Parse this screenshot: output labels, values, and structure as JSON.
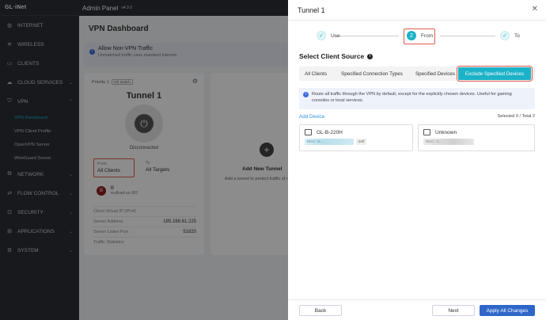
{
  "sidebar": {
    "logo": "GL·iNet",
    "app_title": "Admin Panel",
    "version": "v4.9.0",
    "items": [
      {
        "label": "INTERNET",
        "icon": "globe-icon"
      },
      {
        "label": "WIRELESS",
        "icon": "wifi-icon"
      },
      {
        "label": "CLIENTS",
        "icon": "monitor-icon"
      },
      {
        "label": "CLOUD SERVICES",
        "icon": "cloud-icon"
      },
      {
        "label": "VPN",
        "icon": "shield-icon"
      },
      {
        "label": "NETWORK",
        "icon": "network-icon"
      },
      {
        "label": "FLOW CONTROL",
        "icon": "flow-icon"
      },
      {
        "label": "SECURITY",
        "icon": "lock-icon"
      },
      {
        "label": "APPLICATIONS",
        "icon": "apps-icon"
      },
      {
        "label": "SYSTEM",
        "icon": "gear-icon"
      }
    ],
    "vpn_sub": [
      "VPN Dashboard",
      "VPN Client Profile",
      "OpenVPN Server",
      "WireGuard Server"
    ]
  },
  "background": {
    "page_title": "VPN Dashboard",
    "allow_title": "Allow Non-VPN Traffic",
    "allow_desc": "Unmatched traffic uses standard internet.",
    "priority": "Priority 1",
    "kill_switch": "Kill Switch",
    "tunnel_name": "Tunnel 1",
    "status": "Disconnected",
    "from_label": "From",
    "from_value": "All Clients",
    "to_label": "To",
    "to_value": "All Targets",
    "client_initial": "B",
    "client_name": "B",
    "client_sub": "mullvad-us-002",
    "rows": [
      {
        "label": "Client Virtual IP (IPv4)",
        "value": ""
      },
      {
        "label": "Server Address",
        "value": "185.188.61.225"
      },
      {
        "label": "Server Listen Port",
        "value": "51820"
      },
      {
        "label": "Traffic Statistics",
        "value": ""
      }
    ],
    "add_tunnel_title": "Add New Tunnel",
    "add_tunnel_desc": "Add a tunnel to protect traffic of routing rules."
  },
  "panel": {
    "title": "Tunnel 1",
    "steps": [
      {
        "num": "✓",
        "label": "Use"
      },
      {
        "num": "2",
        "label": "From"
      },
      {
        "num": "✓",
        "label": "To"
      }
    ],
    "section_title": "Select Client Source",
    "tabs": [
      "All Clients",
      "Specified Connection Types",
      "Specified Devices",
      "Exclude Specified Devices"
    ],
    "note": "Route all traffic through the VPN by default, except for the explicitly chosen devices. Useful for gaming consoles or local services.",
    "add_device": "Add Device",
    "selected_count": "Selected 0 / Total 2",
    "devices": [
      {
        "name": "GL-B-220H",
        "mac": "MAC: E...",
        "tag": "self"
      },
      {
        "name": "Unknown",
        "mac": "MAC: C...",
        "tag": ""
      }
    ],
    "buttons": {
      "back": "Back",
      "next": "Next",
      "apply": "Apply All Changes"
    }
  }
}
